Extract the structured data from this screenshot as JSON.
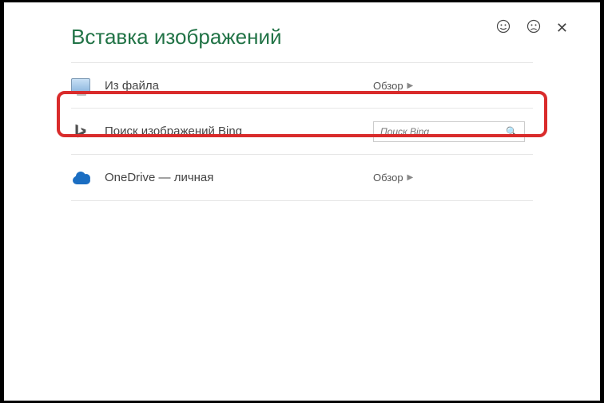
{
  "header": {
    "title": "Вставка изображений"
  },
  "options": {
    "fromFile": {
      "label": "Из файла",
      "action": "Обзор"
    },
    "bing": {
      "label": "Поиск изображений Bing",
      "placeholder": "Поиск Bing"
    },
    "onedrive": {
      "label": "OneDrive — личная",
      "action": "Обзор"
    }
  }
}
